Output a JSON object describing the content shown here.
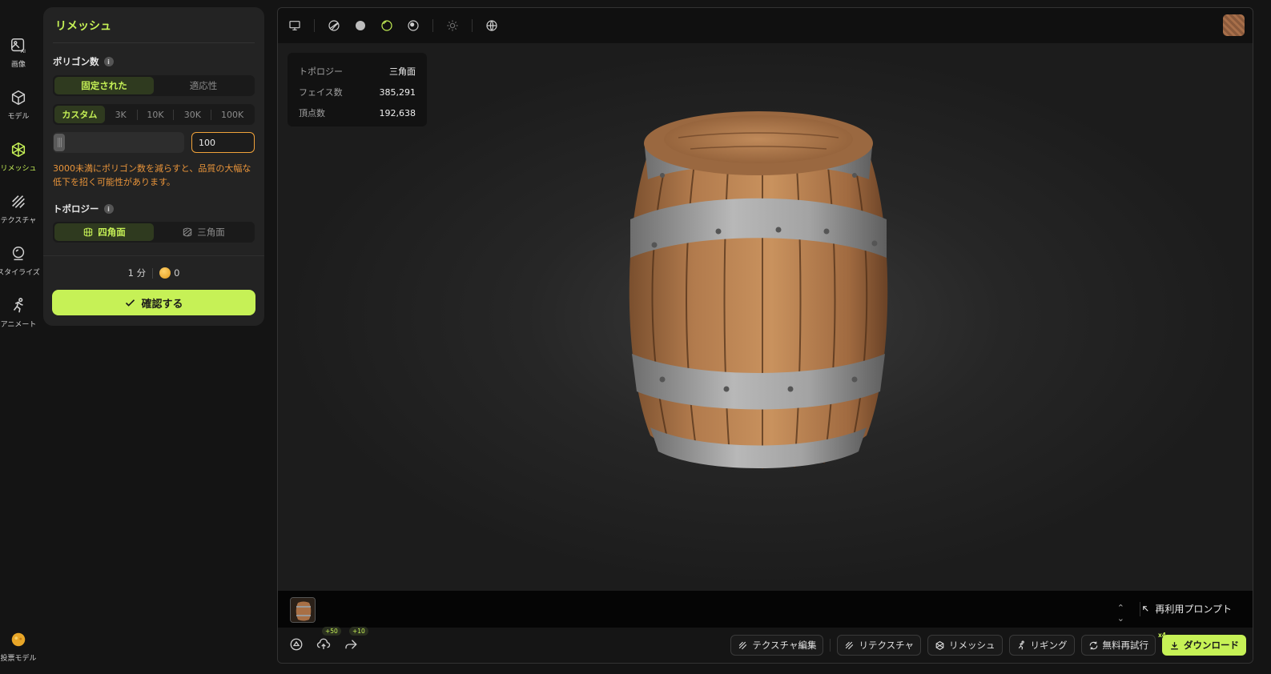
{
  "sidebar": {
    "items": [
      {
        "label": "画像",
        "icon": "image-ai-icon"
      },
      {
        "label": "モデル",
        "icon": "cube-icon"
      },
      {
        "label": "リメッシュ",
        "icon": "remesh-icon",
        "active": true
      },
      {
        "label": "テクスチャ",
        "icon": "texture-icon"
      },
      {
        "label": "スタイライズ",
        "icon": "stylize-icon"
      },
      {
        "label": "アニメート",
        "icon": "animate-icon"
      }
    ],
    "bottom": {
      "label": "投票モデル",
      "icon": "vote-icon"
    }
  },
  "panel": {
    "title": "リメッシュ",
    "polygon_label": "ポリゴン数",
    "mode_options": [
      {
        "label": "固定された",
        "active": true
      },
      {
        "label": "適応性",
        "active": false
      }
    ],
    "presets": [
      {
        "label": "カスタム",
        "active": true
      },
      {
        "label": "3K"
      },
      {
        "label": "10K"
      },
      {
        "label": "30K"
      },
      {
        "label": "100K"
      }
    ],
    "slider_value_fraction": 0.0,
    "input_value": "100",
    "warning": "3000未満にポリゴン数を減らすと、品質の大幅な低下を招く可能性があります。",
    "topology_label": "トポロジー",
    "topology_options": [
      {
        "label": "四角面",
        "active": true
      },
      {
        "label": "三角面",
        "active": false
      }
    ],
    "time": "1 分",
    "cost": "0",
    "confirm_label": "確認する"
  },
  "viewer": {
    "stats": [
      {
        "key": "トポロジー",
        "value": "三角面"
      },
      {
        "key": "フェイス数",
        "value": "385,291"
      },
      {
        "key": "頂点数",
        "value": "192,638"
      }
    ],
    "reuse_prompt": "再利用プロンプト",
    "badges": {
      "upload": "+50",
      "share": "+10"
    },
    "actions": [
      {
        "label": "テクスチャ編集"
      },
      {
        "label": "リテクスチャ"
      },
      {
        "label": "リメッシュ"
      },
      {
        "label": "リギング"
      },
      {
        "label": "無料再試行"
      },
      {
        "label": "ダウンロード",
        "primary": true
      }
    ],
    "download_badge": "x4"
  },
  "colors": {
    "accent": "#c6f156",
    "warning": "#e9943a",
    "background": "#141414"
  }
}
